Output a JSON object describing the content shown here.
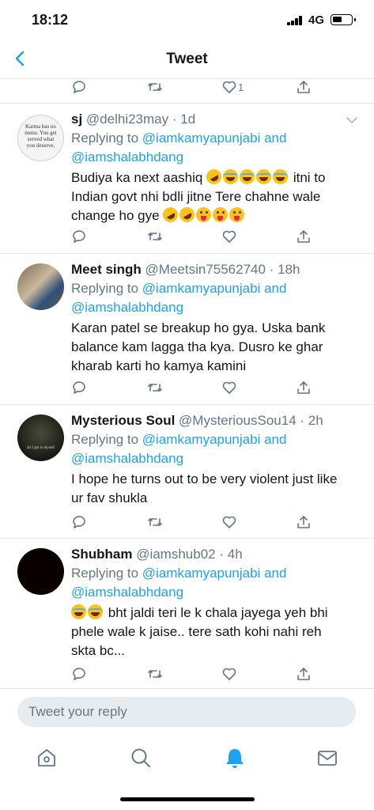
{
  "status_bar": {
    "time": "18:12",
    "network": "4G"
  },
  "nav": {
    "title": "Tweet"
  },
  "top_tweet_actions": {
    "like_count": "1"
  },
  "tweets": [
    {
      "name": "sj",
      "handle": "@delhi23may",
      "time": "· 1d",
      "avatar_text": "Karma has no menu. You get served what you deserve.",
      "reply_prefix": "Replying to",
      "mention_1": "@iamkamyapunjabi",
      "and": "and",
      "mention_2": "@iamshalabhdang",
      "line_1": "Budiya ka next aashiq",
      "line_1_end": "itni to",
      "line_2": "Indian govt nhi bdli jitne Tere chahne wale",
      "line_3": "change ho gye"
    },
    {
      "name": "Meet singh",
      "handle": "@Meetsin75562740",
      "time": "· 18h",
      "reply_prefix": "Replying to",
      "mention_1": "@iamkamyapunjabi",
      "and": "and",
      "mention_2": "@iamshalabhdang",
      "line_1": "Karan patel se breakup ho gya. Uska bank",
      "line_2": "balance kam lagga tha kya. Dusro ke ghar",
      "line_3": "kharab karti ho kamya kamini"
    },
    {
      "name": "Mysterious Soul",
      "handle": "@MysteriousSou14",
      "time": "· 2h",
      "avatar_text": "all I got is myself",
      "reply_prefix": "Replying to",
      "mention_1": "@iamkamyapunjabi",
      "and": "and",
      "mention_2": "@iamshalabhdang",
      "line_1": "I hope he turns out to be very violent just like",
      "line_2": "ur fav shukla"
    },
    {
      "name": "Shubham",
      "handle": "@iamshub02",
      "time": "· 4h",
      "reply_prefix": "Replying to",
      "mention_1": "@iamkamyapunjabi",
      "and": "and",
      "mention_2": "@iamshalabhdang",
      "line_1": "bht jaldi teri le k chala jayega yeh bhi",
      "line_2": "phele wale k jaise.. tere sath kohi nahi reh",
      "line_3": "skta bc..."
    }
  ],
  "reply_bar": {
    "placeholder": "Tweet your reply"
  },
  "tab_bar": {
    "active": "notifications"
  },
  "colors": {
    "accent": "#1da1f2",
    "secondary_text": "#657786",
    "divider": "#e1e8ed"
  },
  "icons": [
    "back-icon",
    "reply-icon",
    "retweet-icon",
    "like-icon",
    "share-icon",
    "chevron-down-icon",
    "home-icon",
    "search-icon",
    "notifications-icon",
    "messages-icon"
  ]
}
